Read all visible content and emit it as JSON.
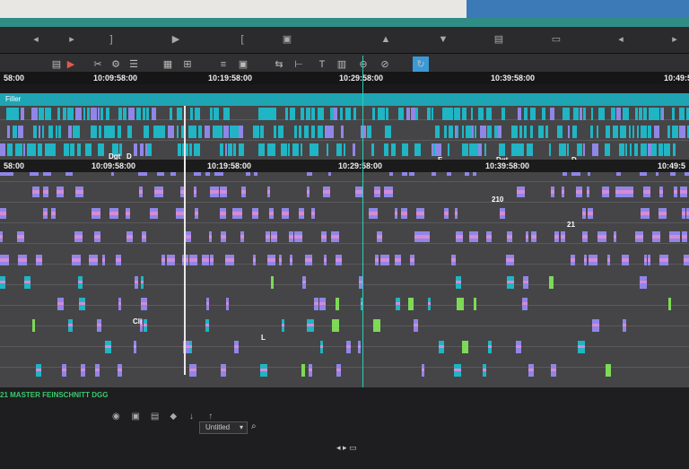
{
  "timecodes": {
    "top": [
      "58:00",
      "10:09:58:00",
      "10:19:58:00",
      "10:29:58:00",
      "10:39:58:00",
      "10:49:5"
    ],
    "mid": [
      "58:00",
      "10:09:58:00",
      "10:19:58:00",
      "10:29:58:00",
      "10:39:58:00",
      "10:49:5"
    ]
  },
  "filler_label": "Filler",
  "clip_labels": [
    "Dgt",
    "D",
    "Dgt",
    "D",
    "E",
    "210",
    "21",
    "Cli",
    "L"
  ],
  "sequence_name": "21 MASTER FEINSCHNITT DGG",
  "bin_select": "Untitled",
  "icons": {
    "ctrl": [
      "mark-in-icon",
      "play-icon",
      "mark-out-icon",
      "bracket-icon",
      "trim-icon",
      "lift-icon",
      "extract-icon",
      "settings-icon",
      "rewind-icon",
      "forward-icon"
    ],
    "tools": [
      "segment-icon",
      "splice-icon",
      "cut-icon",
      "scissor-icon",
      "list-icon",
      "grid-icon",
      "snap-icon",
      "ripple-icon",
      "roll-icon",
      "slip-icon",
      "text-icon",
      "film-icon",
      "extract-icon",
      "no-icon",
      "curve-icon",
      "select-tool-icon"
    ],
    "status": [
      "record-icon",
      "monitor-icon",
      "display-icon",
      "tag-icon",
      "down-arrow-icon",
      "up-arrow-icon",
      "search-icon"
    ]
  },
  "colors": {
    "cyan": "#1fb5c4",
    "purple": "#8f86e8",
    "pink": "#d58bd6",
    "green": "#7ed957",
    "accent": "#26d0b8"
  }
}
